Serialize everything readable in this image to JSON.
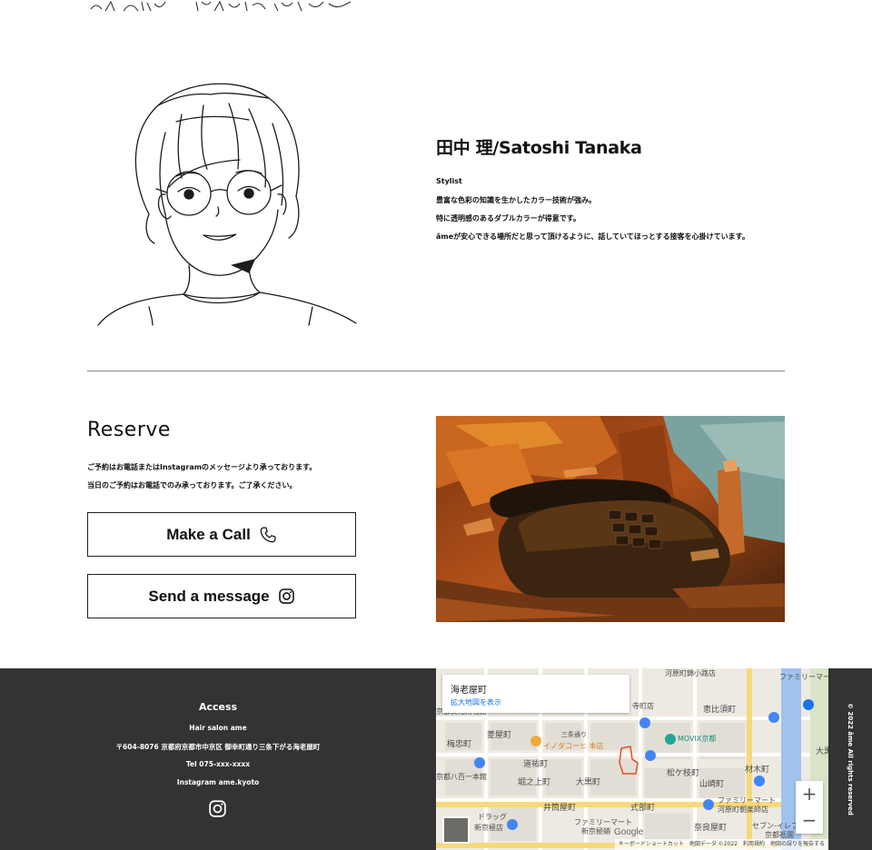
{
  "staff": {
    "name": "田中 理/Satoshi Tanaka",
    "role": "Stylist",
    "lines": [
      "豊富な色彩の知識を生かしたカラー技術が強み。",
      "特に透明感のあるダブルカラーが得意です。",
      "âmeが安心できる場所だと思って頂けるように、話していてほっとする接客を心掛けています。"
    ]
  },
  "reserve": {
    "title": "Reserve",
    "lines": [
      "ご予約はお電話またはInstagramのメッセージより承っております。",
      "当日のご予約はお電話でのみ承っております。ご了承ください。"
    ],
    "call_label": "Make a Call",
    "message_label": "Send a message"
  },
  "footer": {
    "access_title": "Access",
    "salon_name": "Hair salon ame",
    "address": "〒604-8076 京都府京都市中京区 御幸町通り三条下がる海老屋町",
    "tel": "Tel 075-xxx-xxxx",
    "instagram": "Instagram ame.kyoto",
    "copyright": "© 2022 âme All rights reserved"
  },
  "map": {
    "place_title": "海老屋町",
    "larger_map_link": "拡大地図を表示",
    "zoom_in": "+",
    "zoom_out": "−",
    "google": "Google",
    "attribution": "キーボードショートカット　地図データ ©2022　利用規約　地図の誤りを報告する",
    "labels": [
      "海老屋町",
      "河原町錦小路店",
      "ファミリーマート",
      "寺町店",
      "京都文化博物館",
      "恵比須町",
      "菱屋町",
      "三条通り",
      "梅忠町",
      "イノダコーヒ 本店",
      "MOVIX京都",
      "道祐町",
      "京都八百一本館",
      "堀之上町",
      "大黒町",
      "松ケ枝町",
      "山崎町",
      "材木町",
      "井筒屋町",
      "ファミリーマート",
      "河原町朝楽師店",
      "式部町",
      "ファミリーマート",
      "新京極蛸",
      "奈良屋町",
      "セブン-イレブン",
      "京都祇園",
      "ドラッグ",
      "新京極店",
      "大黒"
    ],
    "colors": {
      "land": "#eeeae2",
      "road": "#ffffff",
      "major_road": "#f6d97a",
      "river": "#9fc3ee",
      "poi": "#4285f4",
      "poi_food": "#f2a93b",
      "poi_teal": "#23a697"
    }
  }
}
